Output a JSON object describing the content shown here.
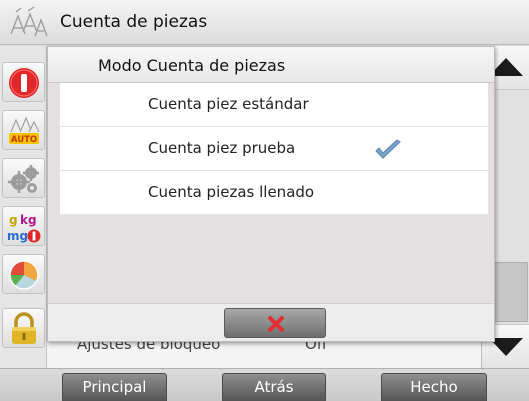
{
  "header": {
    "title": "Cuenta de piezas",
    "icon": "parts-count-icon"
  },
  "sidebar": {
    "items": [
      {
        "icon": "power-icon"
      },
      {
        "icon": "auto-icon",
        "text": "AUTO"
      },
      {
        "icon": "gears-icon"
      },
      {
        "icon": "units-icon",
        "text_top": "g kg",
        "text_bottom": "mg"
      },
      {
        "icon": "pie-chart-icon"
      },
      {
        "icon": "lock-icon"
      }
    ]
  },
  "background": {
    "row_label": "Ajustes de bloqueo",
    "row_value": "Off"
  },
  "modal": {
    "title": "Modo Cuenta de piezas",
    "options": [
      {
        "label": "Cuenta piez estándar",
        "checked": false
      },
      {
        "label": "Cuenta piez prueba",
        "checked": true
      },
      {
        "label": "Cuenta piezas llenado",
        "checked": false
      }
    ],
    "cancel_icon": "close-x-icon"
  },
  "scrollbar": {
    "up_icon": "arrow-up-icon",
    "down_icon": "arrow-down-icon"
  },
  "footer": {
    "principal": "Principal",
    "atras": "Atrás",
    "hecho": "Hecho"
  },
  "colors": {
    "accent_red": "#e03030",
    "check_blue": "#7aa3c9",
    "button_gray": "#6e6e6e"
  }
}
